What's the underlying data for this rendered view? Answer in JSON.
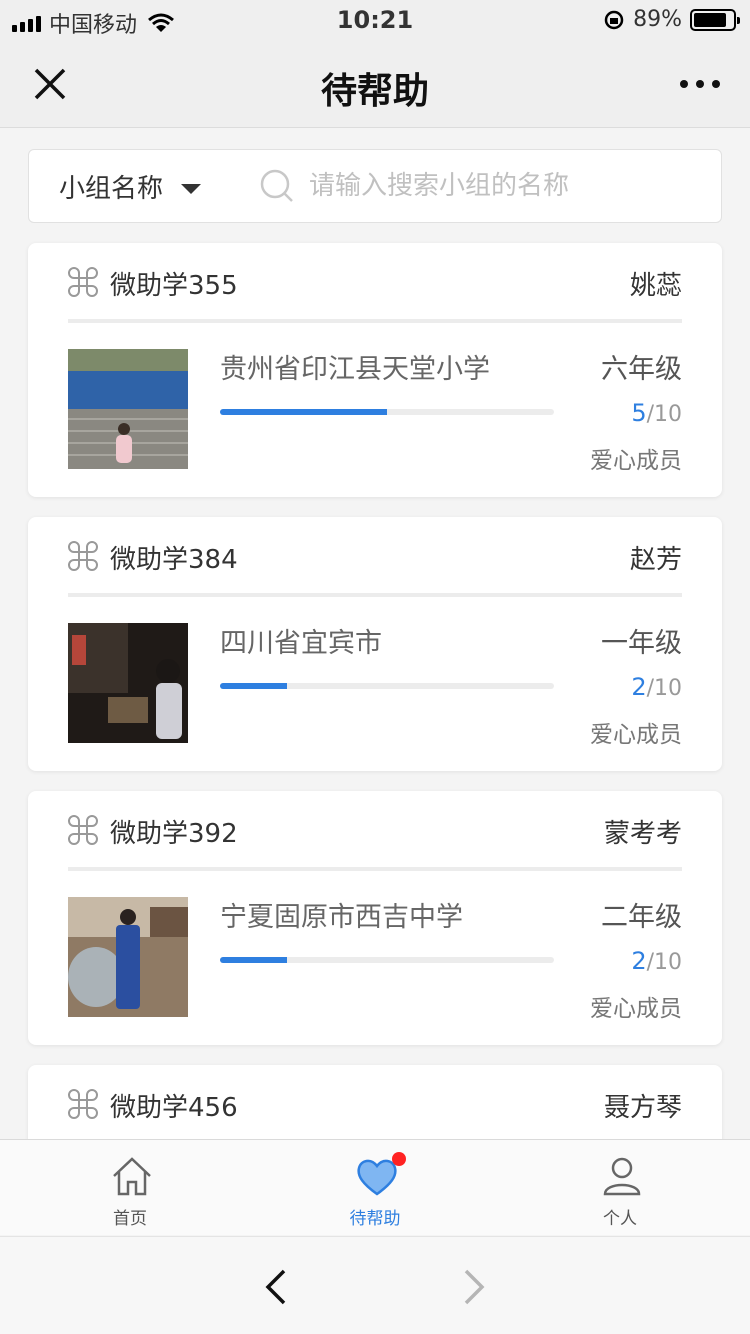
{
  "status_bar": {
    "carrier": "中国移动",
    "time": "10:21",
    "battery": "89%"
  },
  "navbar": {
    "title": "待帮助"
  },
  "search": {
    "filter_label": "小组名称",
    "placeholder": "请输入搜索小组的名称"
  },
  "cards": [
    {
      "group": "微助学355",
      "person": "姚蕊",
      "school": "贵州省印江县天堂小学",
      "grade": "六年级",
      "current": "5",
      "total": "/10",
      "progress": 0.5,
      "member": "爱心成员"
    },
    {
      "group": "微助学384",
      "person": "赵芳",
      "school": "四川省宜宾市",
      "grade": "一年级",
      "current": "2",
      "total": "/10",
      "progress": 0.2,
      "member": "爱心成员"
    },
    {
      "group": "微助学392",
      "person": "蒙考考",
      "school": "宁夏固原市西吉中学",
      "grade": "二年级",
      "current": "2",
      "total": "/10",
      "progress": 0.2,
      "member": "爱心成员"
    },
    {
      "group": "微助学456",
      "person": "聂方琴"
    }
  ],
  "tabbar": {
    "home": "首页",
    "help": "待帮助",
    "me": "个人"
  },
  "colors": {
    "accent": "#2e7fe0",
    "badge": "#ff2222"
  }
}
